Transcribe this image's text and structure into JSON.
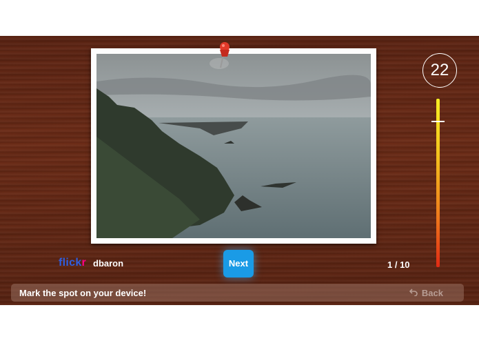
{
  "game": {
    "timer_value": "22",
    "meter_level_fraction": 0.13,
    "photo_source": "flickr",
    "photo_source_parts": [
      "flick",
      "r"
    ],
    "photo_author": "dbaron",
    "next_label": "Next",
    "progress": "1 / 10",
    "instruction": "Mark the spot on your device!",
    "back_label": "Back"
  },
  "icons": {
    "pin": "pushpin-icon",
    "back": "undo-arrow-icon"
  },
  "colors": {
    "wood": "#6d2c17",
    "next_button": "#1a9be6",
    "flickr_blue": "#2f5ee0",
    "flickr_pink": "#ff0084",
    "meter_top": "#f7f024",
    "meter_bottom": "#e02a14"
  }
}
